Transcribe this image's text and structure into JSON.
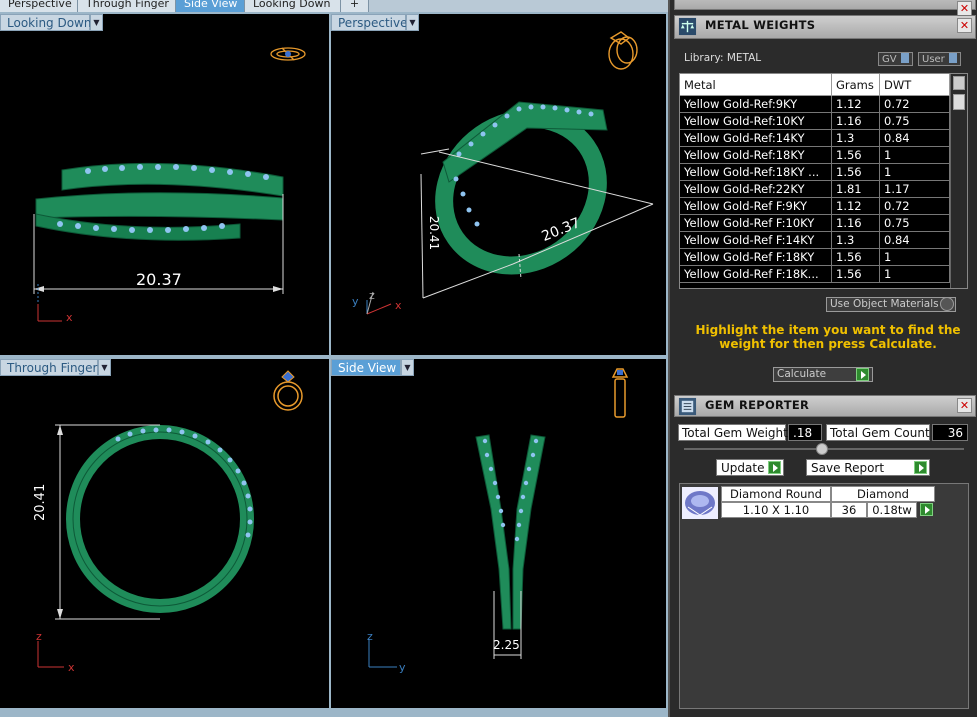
{
  "tabs": [
    {
      "label": "Perspective",
      "active": false
    },
    {
      "label": "Through Finger",
      "active": false
    },
    {
      "label": "Side View",
      "active": true
    },
    {
      "label": "Looking Down",
      "active": false
    },
    {
      "label": "+",
      "active": false
    }
  ],
  "viewports": {
    "looking_down": {
      "label": "Looking Down",
      "dimension": "20.37",
      "axis_h": "x"
    },
    "perspective": {
      "label": "Perspective",
      "dimension_a": "20.37",
      "dimension_b": "20.41",
      "axis_y": "y",
      "axis_z": "z",
      "axis_x": "x"
    },
    "through_finger": {
      "label": "Through Finger",
      "dimension": "20.41",
      "axis_v": "z",
      "axis_h": "x"
    },
    "side_view": {
      "label": "Side View",
      "dimension": "2.25",
      "axis_v": "z",
      "axis_h": "y"
    }
  },
  "metal_weights": {
    "title": "METAL WEIGHTS",
    "library_label": "Library: METAL",
    "gv_label": "GV",
    "user_label": "User",
    "columns": [
      "Metal",
      "Grams",
      "DWT"
    ],
    "rows": [
      {
        "metal": "Yellow Gold-Ref:9KY",
        "grams": "1.12",
        "dwt": "0.72"
      },
      {
        "metal": "Yellow Gold-Ref:10KY",
        "grams": "1.16",
        "dwt": "0.75"
      },
      {
        "metal": "Yellow Gold-Ref:14KY",
        "grams": "1.3",
        "dwt": "0.84"
      },
      {
        "metal": "Yellow Gold-Ref:18KY",
        "grams": "1.56",
        "dwt": "1"
      },
      {
        "metal": "Yellow Gold-Ref:18KY ...",
        "grams": "1.56",
        "dwt": "1"
      },
      {
        "metal": "Yellow Gold-Ref:22KY",
        "grams": "1.81",
        "dwt": "1.17"
      },
      {
        "metal": "Yellow Gold-Ref F:9KY",
        "grams": "1.12",
        "dwt": "0.72"
      },
      {
        "metal": "Yellow Gold-Ref F:10KY",
        "grams": "1.16",
        "dwt": "0.75"
      },
      {
        "metal": "Yellow Gold-Ref F:14KY",
        "grams": "1.3",
        "dwt": "0.84"
      },
      {
        "metal": "Yellow Gold-Ref F:18KY",
        "grams": "1.56",
        "dwt": "1"
      },
      {
        "metal": "Yellow Gold-Ref F:18K...",
        "grams": "1.56",
        "dwt": "1"
      }
    ],
    "use_object_materials": "Use Object Materials",
    "hint": "Highlight the item you want to find the weight for then press Calculate.",
    "calculate_label": "Calculate"
  },
  "gem_reporter": {
    "title": "GEM REPORTER",
    "total_weight_label": "Total Gem Weight",
    "total_weight_value": ".18",
    "total_count_label": "Total Gem Count",
    "total_count_value": "36",
    "update_label": "Update",
    "save_report_label": "Save Report",
    "gem_headers": [
      "Diamond Round",
      "Diamond"
    ],
    "gem_size": "1.10 X 1.10",
    "gem_count": "36",
    "gem_weight": "0.18tw"
  },
  "colors": {
    "metal_green": "#1f8c5a",
    "gem_blue": "#8fc4f0",
    "hint_yellow": "#f0c000"
  }
}
